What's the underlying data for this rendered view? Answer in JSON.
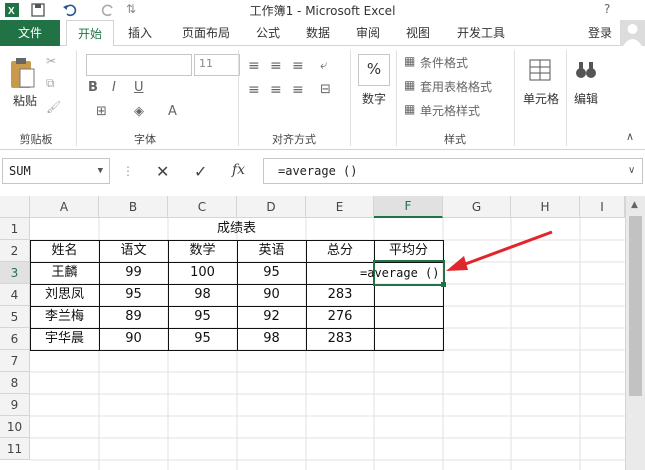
{
  "window": {
    "title": "工作簿1 - Microsoft Excel"
  },
  "tabs": {
    "file": "文件",
    "home": "开始",
    "insert": "插入",
    "page_layout": "页面布局",
    "formulas": "公式",
    "data": "数据",
    "review": "审阅",
    "view": "视图",
    "developer": "开发工具",
    "login": "登录"
  },
  "ribbon": {
    "paste": "粘贴",
    "clipboard_label": "剪贴板",
    "font_size": "11",
    "font_label": "字体",
    "align_label": "对齐方式",
    "number_percent": "%",
    "number": "数字",
    "cond_format": "条件格式",
    "table_format": "套用表格格式",
    "cell_style": "单元格样式",
    "styles_label": "样式",
    "cells": "单元格",
    "editing": "编辑",
    "bold": "B",
    "italic": "I",
    "underline": "U",
    "font_color": "A"
  },
  "formula_bar": {
    "name_box": "SUM",
    "cancel": "✕",
    "enter": "✓",
    "fx": "fx",
    "formula": "=average ()"
  },
  "grid": {
    "columns": [
      "A",
      "B",
      "C",
      "D",
      "E",
      "F",
      "G",
      "H",
      "I"
    ],
    "rows": [
      "1",
      "2",
      "3",
      "4",
      "5",
      "6",
      "7",
      "8",
      "9",
      "10",
      "11"
    ],
    "title": "成绩表",
    "headers": [
      "姓名",
      "语文",
      "数学",
      "英语",
      "总分",
      "平均分"
    ],
    "data": [
      [
        "王麟",
        "99",
        "100",
        "95",
        "",
        "=average ()"
      ],
      [
        "刘思凤",
        "95",
        "98",
        "90",
        "283",
        ""
      ],
      [
        "李兰梅",
        "89",
        "95",
        "92",
        "276",
        ""
      ],
      [
        "宇华晨",
        "90",
        "95",
        "98",
        "283",
        ""
      ]
    ]
  },
  "colors": {
    "accent": "#217346",
    "annotation": "#e0262c"
  }
}
